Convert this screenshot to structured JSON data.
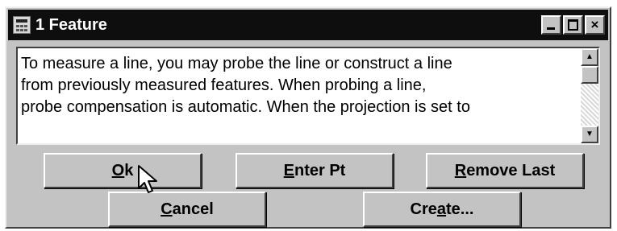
{
  "window": {
    "title": "1 Feature",
    "title_icon": "calculator-icon"
  },
  "titlebar_buttons": {
    "minimize": "minimize-icon",
    "maximize": "maximize-icon",
    "close_glyph": "×"
  },
  "description": {
    "text": "To measure a line, you may probe the line or construct a line\nfrom previously measured features.  When probing a line,\nprobe compensation is automatic.  When the projection is set to"
  },
  "scrollbar": {
    "up_glyph": "▲",
    "down_glyph": "▼"
  },
  "buttons": {
    "ok": {
      "mnemonic": "O",
      "rest": "k"
    },
    "enter_pt": {
      "mnemonic": "E",
      "rest": "nter Pt"
    },
    "remove_last": {
      "mnemonic": "R",
      "rest": "emove Last"
    },
    "cancel": {
      "mnemonic": "C",
      "rest": "ancel"
    },
    "create": {
      "pre": "Cre",
      "mnemonic": "a",
      "rest": "te..."
    }
  },
  "colors": {
    "titlebar": "#0e0e0e",
    "face": "#c3c3c3"
  }
}
